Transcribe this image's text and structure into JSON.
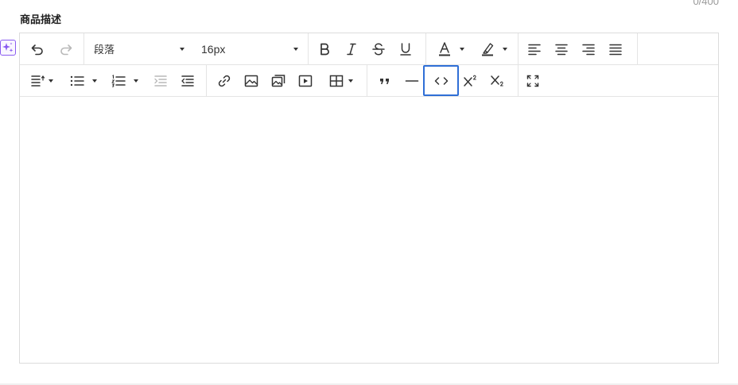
{
  "field": {
    "label": "商品描述",
    "counter": "0/400"
  },
  "toolbar": {
    "paragraph_select": "段落",
    "font_size_select": "16px"
  },
  "icons": {
    "ai": "sparkle-icon",
    "undo": "undo-icon",
    "redo": "redo-icon",
    "bold": "bold-icon",
    "italic": "italic-icon",
    "strike": "strikethrough-icon",
    "underline": "underline-icon",
    "font_color": "font-color-icon",
    "bg_color": "highlight-color-icon",
    "align_left": "align-left-icon",
    "align_center": "align-center-icon",
    "align_right": "align-right-icon",
    "justify": "justify-icon",
    "line_height": "line-height-icon",
    "bullet_list": "bullet-list-icon",
    "numbered_list": "numbered-list-icon",
    "indent": "indent-icon",
    "outdent": "outdent-icon",
    "link": "link-icon",
    "image": "image-icon",
    "image_gallery": "image-gallery-icon",
    "video": "video-icon",
    "table": "table-icon",
    "quote": "quote-icon",
    "divider": "horizontal-rule-icon",
    "code": "code-icon",
    "superscript": "superscript-icon",
    "subscript": "subscript-icon",
    "fullscreen": "fullscreen-icon"
  },
  "colors": {
    "accent_highlight": "#2f6fd6",
    "ai_purple": "#8a5cf0",
    "border": "#dcdcdc",
    "icon": "#333333",
    "disabled_icon": "#b8b8b8"
  }
}
